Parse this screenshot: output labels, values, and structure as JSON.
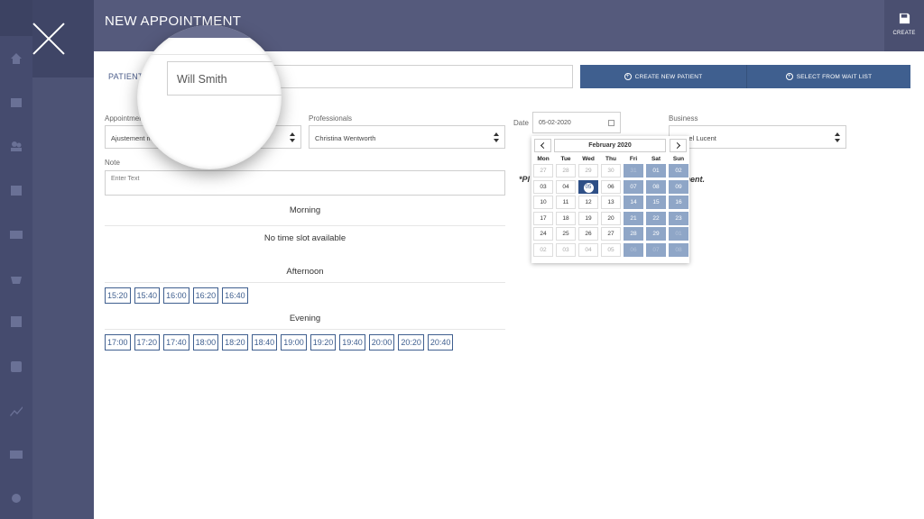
{
  "header": {
    "title": "NEW APPOINTMENT",
    "create_label": "CREATE"
  },
  "patient": {
    "label": "PATIENT",
    "value": "Will Smith"
  },
  "buttons": {
    "create_new_patient": "CREATE NEW PATIENT",
    "select_from_wait_list": "SELECT FROM WAIT LIST"
  },
  "form": {
    "appointment_label": "Appointment",
    "appointment_value": "Ajustement m",
    "professionals_label": "Professionals",
    "professionals_value": "Christina Wentworth",
    "date_label": "Date",
    "date_value": "05-02-2020",
    "business_label": "Business",
    "business_value": "Hostel Lucent",
    "note_label": "Note",
    "note_placeholder": "Enter Text"
  },
  "sections": {
    "morning": "Morning",
    "no_slot": "No time slot available",
    "afternoon": "Afternoon",
    "evening": "Evening"
  },
  "afternoon_slots": [
    "15:20",
    "15:40",
    "16:00",
    "16:20",
    "16:40"
  ],
  "evening_slots": [
    "17:00",
    "17:20",
    "17:40",
    "18:00",
    "18:20",
    "18:40",
    "19:00",
    "19:20",
    "19:40",
    "20:00",
    "20:20",
    "20:40"
  ],
  "hint": {
    "left": "*Pl",
    "right": "ment."
  },
  "calendar": {
    "month": "February 2020",
    "days_of_week": [
      "Mon",
      "Tue",
      "Wed",
      "Thu",
      "Fri",
      "Sat",
      "Sun"
    ],
    "selected": "05",
    "weeks": [
      [
        "27",
        "28",
        "29",
        "30",
        "31",
        "01",
        "02"
      ],
      [
        "03",
        "04",
        "05",
        "06",
        "07",
        "08",
        "09"
      ],
      [
        "10",
        "11",
        "12",
        "13",
        "14",
        "15",
        "16"
      ],
      [
        "17",
        "18",
        "19",
        "20",
        "21",
        "22",
        "23"
      ],
      [
        "24",
        "25",
        "26",
        "27",
        "28",
        "29",
        "01"
      ],
      [
        "02",
        "03",
        "04",
        "05",
        "06",
        "07",
        "08"
      ]
    ]
  },
  "colors": {
    "header": "#555a7c",
    "primary": "#3f5f8f",
    "weekend": "#8fa6c7",
    "selected": "#2e4f86"
  }
}
